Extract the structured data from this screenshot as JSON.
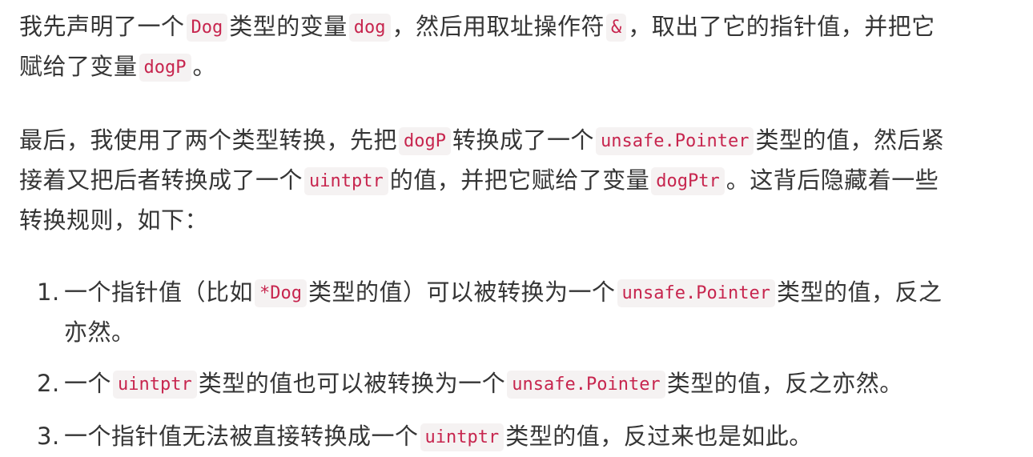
{
  "paragraph1": {
    "line1": {
      "t1": "我先声明了一个",
      "c1": "Dog",
      "t2": "类型的变量",
      "c2": "dog",
      "t3": "，然后用取址操作符",
      "c3": "&",
      "t4": "，取出了它的指针值，并把它"
    },
    "line2": {
      "t1": "赋给了变量",
      "c1": "dogP",
      "t2": "。"
    }
  },
  "paragraph2": {
    "line1": {
      "t1": "最后，我使用了两个类型转换，先把",
      "c1": "dogP",
      "t2": "转换成了一个",
      "c2": "unsafe.Pointer",
      "t3": "类型的值，然后紧"
    },
    "line2": {
      "t1": "接着又把后者转换成了一个",
      "c1": "uintptr",
      "t2": "的值，并把它赋给了变量",
      "c2": "dogPtr",
      "t3": "。这背后隐藏着一些"
    },
    "line3": {
      "t1": "转换规则，如下："
    }
  },
  "rules": [
    {
      "marker": "1.",
      "line1": {
        "t1": "一个指针值（比如",
        "c1": "*Dog",
        "t2": "类型的值）可以被转换为一个",
        "c2": "unsafe.Pointer",
        "t3": "类型的值，反之"
      },
      "line2": {
        "t1": "亦然。"
      }
    },
    {
      "marker": "2.",
      "t1": "一个",
      "c1": "uintptr",
      "t2": "类型的值也可以被转换为一个",
      "c2": "unsafe.Pointer",
      "t3": "类型的值，反之亦然。"
    },
    {
      "marker": "3.",
      "t1": "一个指针值无法被直接转换成一个",
      "c1": "uintptr",
      "t2": "类型的值，反过来也是如此。"
    }
  ],
  "colors": {
    "text": "#353535",
    "code_text": "#c7254e",
    "code_background": "#f5f2f2",
    "page_background": "#ffffff"
  }
}
